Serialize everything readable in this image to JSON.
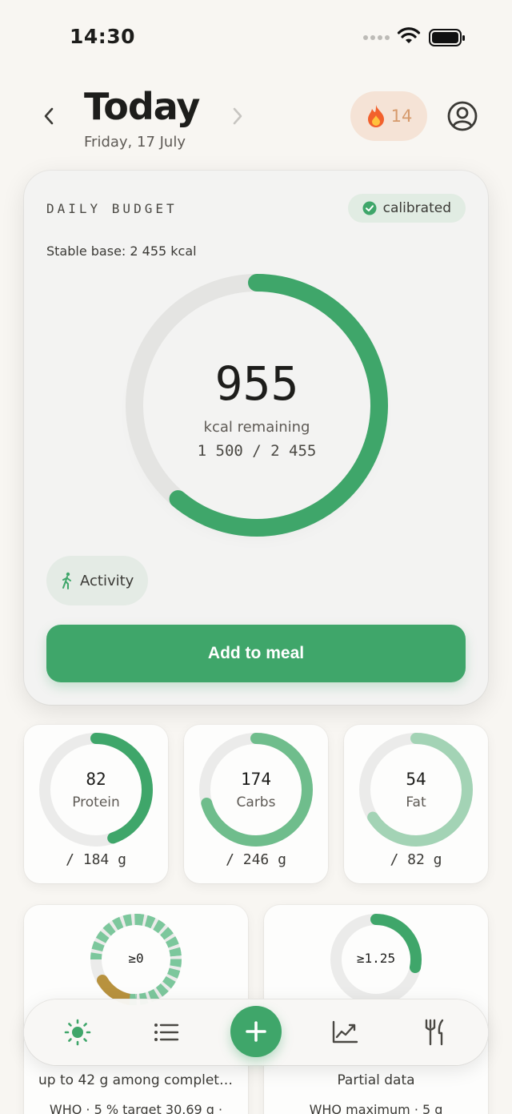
{
  "status_bar": {
    "time": "14:30"
  },
  "header": {
    "title": "Today",
    "date": "Friday, 17 July",
    "streak_count": "14",
    "prev_icon": "chevron-left-icon",
    "next_icon": "chevron-right-icon"
  },
  "budget": {
    "label": "DAILY BUDGET",
    "badge": "calibrated",
    "stable_base": "Stable base: 2 455 kcal",
    "remaining": "955",
    "remaining_label": "kcal remaining",
    "ratio": "1 500 / 2 455",
    "progress": 0.611,
    "activity_label": "Activity",
    "add_button": "Add to meal"
  },
  "macros": [
    {
      "value": "82",
      "name": "Protein",
      "goal": "/ 184 g",
      "progress": 0.446,
      "color": "#3fa66a"
    },
    {
      "value": "174",
      "name": "Carbs",
      "goal": "/ 246 g",
      "progress": 0.707,
      "color": "#6fbd8c"
    },
    {
      "value": "54",
      "name": "Fat",
      "goal": "/ 82 g",
      "progress": 0.659,
      "color": "#a3d3b5"
    }
  ],
  "bottom_cards": [
    {
      "value": "≥0",
      "text": "up to 42 g among complete...",
      "sub": "WHO · 5 % target 30.69 g ·"
    },
    {
      "value": "≥1.25",
      "text": "Partial data",
      "sub": "WHO maximum · 5 g"
    }
  ],
  "colors": {
    "accent": "#3fa66a",
    "background": "#f8f6f2",
    "streak": "#d69a6c"
  },
  "tabbar": {
    "items": [
      "sun-icon",
      "list-icon",
      "plus-icon",
      "chart-icon",
      "utensils-icon"
    ]
  }
}
